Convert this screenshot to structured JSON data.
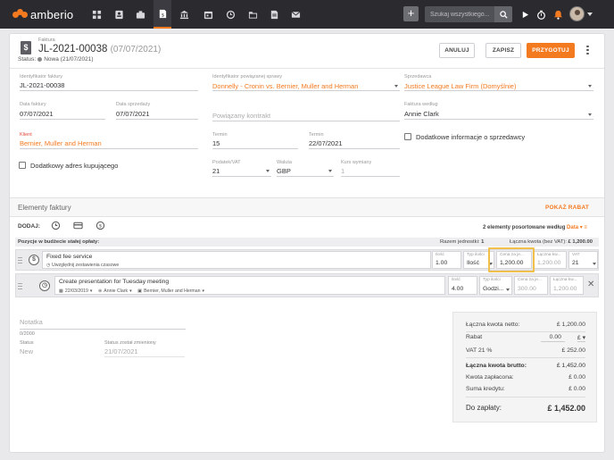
{
  "brand": {
    "name": "amberio",
    "accent": "#f47a20"
  },
  "topbar": {
    "nav_icons": [
      "dashboard-icon",
      "contacts-icon",
      "cases-icon",
      "invoices-icon",
      "bank-icon",
      "calendar-icon",
      "time-icon",
      "folder-icon",
      "documents-icon",
      "mail-icon"
    ],
    "search_placeholder": "Szukaj wszystkiego...",
    "plus_label": "+"
  },
  "header": {
    "doc_label": "Faktura",
    "title": "JL-2021-00038",
    "title_date": "(07/07/2021)",
    "status_label": "Status:",
    "status_value": "Nowa (21/07/2021)",
    "buttons": {
      "cancel": "ANULUJ",
      "save": "ZAPISZ",
      "prepare": "PRZYGOTUJ"
    }
  },
  "form": {
    "invoice_id": {
      "label": "Identyfikator faktury",
      "value": "JL-2021-00038"
    },
    "case_id": {
      "label": "Identyfikator powiązanej sprawy",
      "value": "Donnelly - Cronin vs. Bernier, Muller and Herman"
    },
    "seller": {
      "label": "Sprzedawca",
      "value": "Justice League Law Firm (Domyślnie)"
    },
    "invoice_date": {
      "label": "Data faktury",
      "value": "07/07/2021"
    },
    "sale_date": {
      "label": "Data sprzedaży",
      "value": "07/07/2021"
    },
    "contract": {
      "placeholder": "Powiązany kontrakt"
    },
    "invoice_by": {
      "label": "Faktura według",
      "value": "Annie Clark"
    },
    "client": {
      "label": "Klient",
      "value": "Bernier, Muller and Herman"
    },
    "term_days": {
      "label": "Termin",
      "value": "15"
    },
    "term_date": {
      "label": "Termin",
      "value": "22/07/2021"
    },
    "extra_sale_info": "Dodatkowe informacje o sprzedawcy",
    "extra_buyer_address": "Dodatkowy adres kupującego",
    "vat": {
      "label": "Podatek/VAT",
      "value": "21"
    },
    "currency": {
      "label": "Waluta",
      "value": "GBP"
    },
    "exchange_rate": {
      "label": "Kurs wymiany",
      "value": "1"
    }
  },
  "items": {
    "section_title": "Elementy faktury",
    "discount_link": "POKAŻ RABAT",
    "add_label": "DODAJ:",
    "sort_prefix": "2 elementy posortowane według",
    "sort_field": "Data",
    "budget_label": "Pozycje w budżecie stałej opłaty:",
    "units_total_label": "Razem jednostki:",
    "units_total_value": "1",
    "total_net_label": "Łączna kwota (bez VAT):",
    "total_net_value": "£ 1,200.00",
    "row1": {
      "name": "Fixed fee service",
      "sub": "Uwzględnij zestawienia czasowe",
      "qty_label": "Ilość",
      "qty": "1.00",
      "qtype_label": "Typ ilości",
      "qtype": "Ilość",
      "price_label": "Cena za je...",
      "price": "1,200.00",
      "amount_label": "Łączna kw...",
      "amount": "1,200.00",
      "vat_label": "VAT",
      "vat": "21"
    },
    "row2": {
      "name": "Create presentation for Tuesday meeting",
      "date": "22/03/2019",
      "user": "Annie Clark",
      "client": "Bernier, Muller and Herman",
      "qty_label": "Ilość",
      "qty": "4.00",
      "qtype_label": "Typ ilości",
      "qtype": "Godzi...",
      "price_label": "Cena za je...",
      "price": "300.00",
      "amount_label": "Łączna kw...",
      "amount": "1,200.00"
    }
  },
  "notes": {
    "placeholder": "Notatka",
    "counter": "0/2000",
    "status_label": "Status",
    "status_value": "New",
    "changed_label": "Status został zmieniony",
    "changed_value": "21/07/2021"
  },
  "totals": {
    "net_label": "Łączna kwota netto:",
    "net_value": "£ 1,200.00",
    "discount_label": "Rabat",
    "discount_value": "0.00",
    "discount_unit": "£",
    "vat_label": "VAT 21 %",
    "vat_value": "£ 252.00",
    "gross_label": "Łączna kwota brutto:",
    "gross_value": "£ 1,452.00",
    "paid_label": "Kwota zapłacona:",
    "paid_value": "£ 0.00",
    "credit_label": "Suma kredytu:",
    "credit_value": "£ 0.00",
    "due_label": "Do zapłaty:",
    "due_value": "£ 1,452.00"
  }
}
